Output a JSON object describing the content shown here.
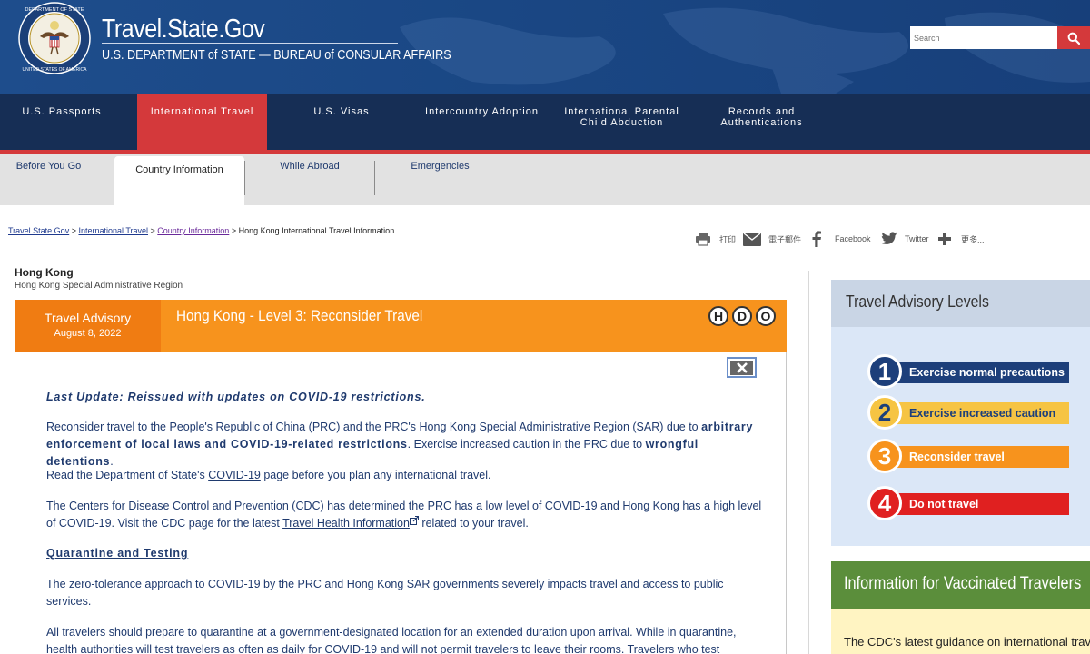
{
  "header": {
    "site_title": "Travel.State.Gov",
    "site_subtitle": "U.S. DEPARTMENT of STATE — BUREAU of CONSULAR AFFAIRS",
    "seal_text": "DEPARTMENT OF STATE · UNITED STATES OF AMERICA",
    "search_placeholder": "Search"
  },
  "main_nav": [
    {
      "label": "U.S. Passports"
    },
    {
      "label": "International Travel",
      "active": true
    },
    {
      "label": "U.S. Visas"
    },
    {
      "label": "Intercountry Adoption"
    },
    {
      "label": "International Parental\nChild Abduction"
    },
    {
      "label": "Records and\nAuthentications"
    }
  ],
  "sub_nav": [
    {
      "label": "Before You Go"
    },
    {
      "label": "Country Information",
      "active": true
    },
    {
      "label": "While Abroad"
    },
    {
      "label": "Emergencies"
    }
  ],
  "breadcrumb": {
    "items": [
      "Travel.State.Gov",
      "International Travel",
      "Country Information"
    ],
    "current": "Hong Kong International Travel Information",
    "separator": " > "
  },
  "share": {
    "print": "打印",
    "email": "電子郵件",
    "facebook": "Facebook",
    "twitter": "Twitter",
    "more": "更多..."
  },
  "country": {
    "name": "Hong Kong",
    "subtitle": "Hong Kong Special Administrative Region"
  },
  "advisory": {
    "label": "Travel Advisory",
    "date": "August 8, 2022",
    "title": "Hong Kong - Level 3: Reconsider Travel",
    "indicators": [
      "H",
      "D",
      "O"
    ],
    "last_update": "Last Update: Reissued with updates on COVID-19 restrictions.",
    "p1_a": "Reconsider travel to the People's Republic of China (PRC) and the PRC's Hong Kong Special Administrative Region (SAR) due to ",
    "p1_bold1": "arbitrary enforcement of local laws and COVID-19-related restrictions",
    "p1_b": ". Exercise increased caution in the PRC due to ",
    "p1_bold2": "wrongful detentions",
    "p1_c": ".",
    "p2_a": "Read the Department of State's ",
    "p2_link": "COVID-19",
    "p2_b": " page before you plan any international travel.",
    "p3_a": "The Centers for Disease Control and Prevention (CDC) has determined the PRC has a low level of COVID-19 and Hong Kong has a high level of COVID-19. Visit the CDC page for the latest ",
    "p3_link": "Travel Health Information",
    "p3_b": " related to your travel.",
    "section_title": "Quarantine and Testing",
    "p4": "The zero-tolerance approach to COVID-19 by the PRC and Hong Kong SAR governments severely impacts travel and access to public services.",
    "p5": "All travelers should prepare to quarantine at a government-designated location for an extended duration upon arrival. While in quarantine, health authorities will test travelers as often as daily for COVID-19 and will not permit travelers to leave their rooms. Travelers who test"
  },
  "levels": {
    "heading": "Travel Advisory Levels",
    "items": [
      {
        "num": "1",
        "label": "Exercise normal precautions",
        "bar_color": "#1d3f7a",
        "text_color": "#ffffff"
      },
      {
        "num": "2",
        "label": "Exercise increased caution",
        "bar_color": "#f6c443",
        "text_color": "#1d3f7a"
      },
      {
        "num": "3",
        "label": "Reconsider travel",
        "bar_color": "#f7931d",
        "text_color": "#ffffff"
      },
      {
        "num": "4",
        "label": "Do not travel",
        "bar_color": "#e02020",
        "text_color": "#ffffff"
      }
    ]
  },
  "vaccinated": {
    "heading": "Information for Vaccinated Travelers",
    "text": "The CDC's latest guidance on international travel"
  },
  "colors": {
    "accent_red": "#d4393b",
    "navy": "#162e55",
    "advisory_orange": "#f7931d"
  }
}
